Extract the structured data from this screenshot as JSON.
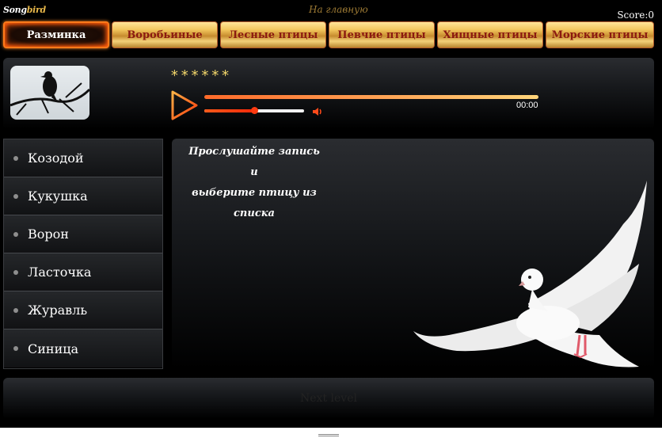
{
  "header": {
    "logo_main": "Song",
    "logo_accent": "bird",
    "home_label": "На главную",
    "score_label": "Score:",
    "score_value": "0"
  },
  "nav": {
    "tabs": [
      {
        "label": "Разминка",
        "active": true
      },
      {
        "label": "Воробьиные",
        "active": false
      },
      {
        "label": "Лесные птицы",
        "active": false
      },
      {
        "label": "Певчие птицы",
        "active": false
      },
      {
        "label": "Хищные птицы",
        "active": false
      },
      {
        "label": "Морские птицы",
        "active": false
      }
    ]
  },
  "player": {
    "hidden_name": "******",
    "time": "00:00",
    "progress": 1.0,
    "volume": 0.5,
    "icons": {
      "play": "play-icon",
      "volume": "speaker-icon",
      "thumbnail": "bird-silhouette-image"
    }
  },
  "birds": [
    "Козодой",
    "Кукушка",
    "Ворон",
    "Ласточка",
    "Журавль",
    "Синица"
  ],
  "info": {
    "line1": "Прослушайте запись",
    "line2": "и",
    "line3": "выберите птицу из списка",
    "image": "white-dove-image"
  },
  "footer": {
    "next_label": "Next level"
  },
  "colors": {
    "accent": "#ff5a1a",
    "tab_text": "#8b1a10",
    "stars": "#f2d66a",
    "gold": "#e8b84a"
  }
}
